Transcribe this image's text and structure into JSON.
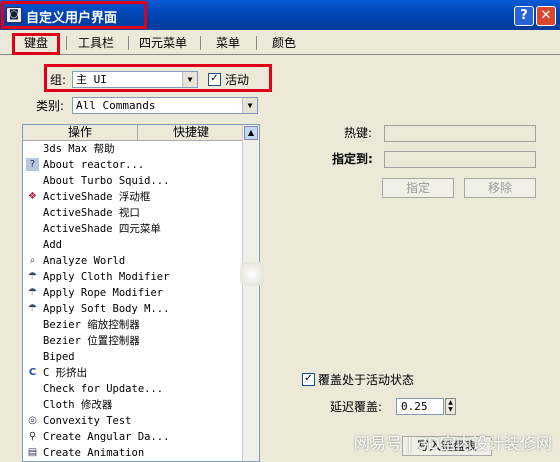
{
  "window": {
    "title": "自定义用户界面",
    "help_label": "?",
    "close_label": "✕"
  },
  "tabs": [
    {
      "label": "键盘",
      "selected": true
    },
    {
      "label": "工具栏"
    },
    {
      "label": "四元菜单"
    },
    {
      "label": "菜单"
    },
    {
      "label": "颜色"
    }
  ],
  "group": {
    "label": "组:",
    "value": "主 UI",
    "active_label": "活动",
    "active_checked": true
  },
  "category": {
    "label": "类别:",
    "value": "All Commands"
  },
  "list": {
    "col_action": "操作",
    "col_shortcut": "快捷键",
    "items": [
      {
        "icon": "",
        "label": "3ds Max 帮助"
      },
      {
        "icon": "help-icon",
        "label": "About reactor..."
      },
      {
        "icon": "",
        "label": "About Turbo Squid..."
      },
      {
        "icon": "activeshade-icon",
        "label": "ActiveShade 浮动框"
      },
      {
        "icon": "",
        "label": "ActiveShade 视口"
      },
      {
        "icon": "",
        "label": "ActiveShade 四元菜单"
      },
      {
        "icon": "",
        "label": "Add"
      },
      {
        "icon": "analyze-icon",
        "label": "Analyze World"
      },
      {
        "icon": "cloth-icon",
        "label": "Apply Cloth Modifier"
      },
      {
        "icon": "rope-icon",
        "label": "Apply Rope Modifier"
      },
      {
        "icon": "softbody-icon",
        "label": "Apply Soft Body M..."
      },
      {
        "icon": "",
        "label": "Bezier 缩放控制器"
      },
      {
        "icon": "",
        "label": "Bezier 位置控制器"
      },
      {
        "icon": "",
        "label": "Biped"
      },
      {
        "icon": "c-extrude-icon",
        "label": "C 形挤出"
      },
      {
        "icon": "",
        "label": "Check for Update..."
      },
      {
        "icon": "",
        "label": "Cloth 修改器"
      },
      {
        "icon": "convexity-icon",
        "label": "Convexity Test"
      },
      {
        "icon": "angular-icon",
        "label": "Create Angular Da..."
      },
      {
        "icon": "animation-icon",
        "label": "Create Animation"
      }
    ]
  },
  "hotkey": {
    "label": "热键:",
    "value": ""
  },
  "assigned_to": {
    "label": "指定到:",
    "value": ""
  },
  "buttons": {
    "assign": "指定",
    "remove": "移除"
  },
  "override": {
    "label": "覆盖处于活动状态",
    "checked": true
  },
  "delay": {
    "label": "延迟覆盖:",
    "value": "0.25"
  },
  "watermark": "网易号 | 3D室内设计装修网",
  "partial_button": "写入键盘表"
}
